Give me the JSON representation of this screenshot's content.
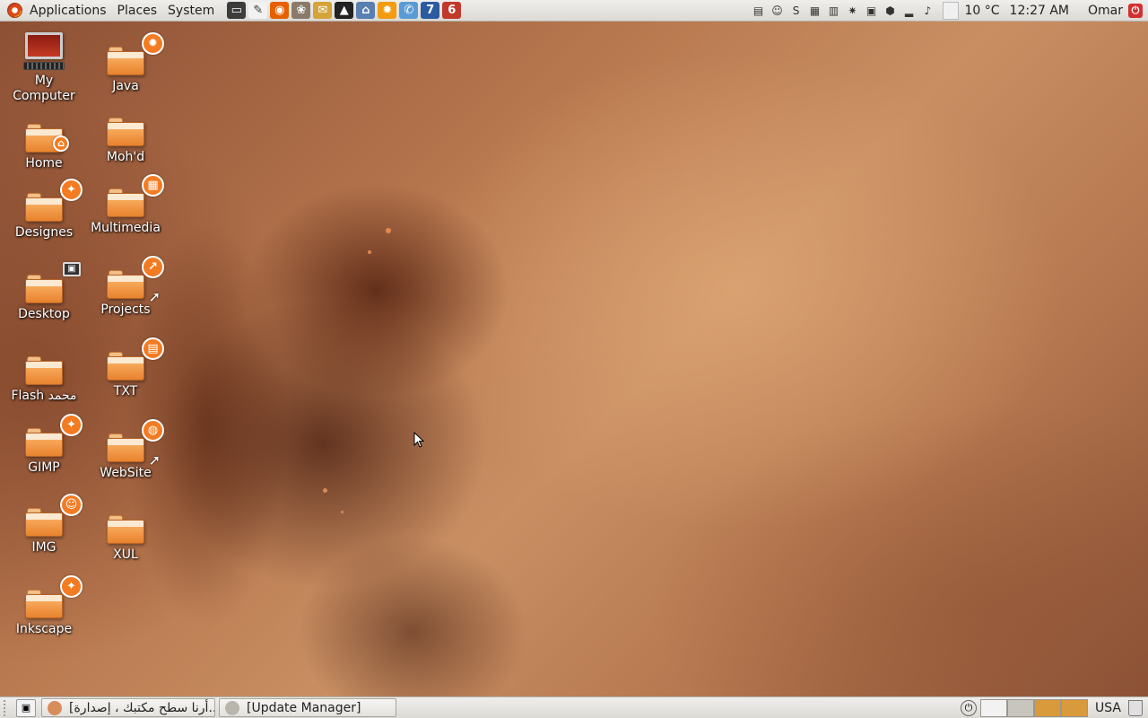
{
  "top_panel": {
    "menus": [
      "Applications",
      "Places",
      "System"
    ],
    "launchers": [
      {
        "icon": "terminal-icon",
        "color": "#3c3c3c",
        "glyph": "▭"
      },
      {
        "icon": "text-editor-icon",
        "color": "#f2f2f2",
        "glyph": "✎"
      },
      {
        "icon": "firefox-icon",
        "color": "#e66000",
        "glyph": "◉"
      },
      {
        "icon": "gimp-icon",
        "color": "#8a7a6a",
        "glyph": "❀"
      },
      {
        "icon": "thunderbird-icon",
        "color": "#d4a33a",
        "glyph": "✉"
      },
      {
        "icon": "inkscape-icon",
        "color": "#222222",
        "glyph": "▲"
      },
      {
        "icon": "network-icon",
        "color": "#5a7fb0",
        "glyph": "⌂"
      },
      {
        "icon": "settings-gear-icon",
        "color": "#f39c12",
        "glyph": "✹"
      },
      {
        "icon": "chat-icon",
        "color": "#5b9bd5",
        "glyph": "✆"
      },
      {
        "icon": "app-7-icon",
        "color": "#2c5aa0",
        "glyph": "7"
      },
      {
        "icon": "app-6-icon",
        "color": "#c0392b",
        "glyph": "6"
      }
    ],
    "tray_icons": [
      {
        "icon": "notes-icon",
        "glyph": "▤"
      },
      {
        "icon": "pidgin-icon",
        "glyph": "☺"
      },
      {
        "icon": "skype-icon",
        "glyph": "S"
      },
      {
        "icon": "system-monitor-icon",
        "glyph": "▦"
      },
      {
        "icon": "calculator-icon",
        "glyph": "▥"
      },
      {
        "icon": "preferences-icon",
        "glyph": "✷"
      },
      {
        "icon": "disk-icon",
        "glyph": "▣"
      },
      {
        "icon": "update-icon",
        "glyph": "⬢"
      },
      {
        "icon": "network-signal-icon",
        "glyph": "▂"
      },
      {
        "icon": "volume-icon",
        "glyph": "♪"
      }
    ],
    "weather": "10 °C",
    "clock": "12:27 AM",
    "user": "Omar"
  },
  "desktop_icons": {
    "column1": [
      {
        "label": "My\nComputer",
        "kind": "computer"
      },
      {
        "label": "Home",
        "emblem": "⌂",
        "emblem_type": "home"
      },
      {
        "label": "Designes",
        "emblem": "✦"
      },
      {
        "label": "Desktop",
        "emblem": "▣",
        "emblem_type": "frame"
      },
      {
        "label": "Flash محمد",
        "emblem": ""
      },
      {
        "label": "GIMP",
        "emblem": "✦"
      },
      {
        "label": "IMG",
        "emblem": "☺"
      },
      {
        "label": "Inkscape",
        "emblem": "✦"
      }
    ],
    "column2": [
      {
        "label": "Java",
        "emblem": "✹"
      },
      {
        "label": "Moh'd",
        "emblem": ""
      },
      {
        "label": "Multimedia",
        "emblem": "▦"
      },
      {
        "label": "Projects",
        "emblem": "↗",
        "link": true
      },
      {
        "label": "TXT",
        "emblem": "▤"
      },
      {
        "label": "WebSite",
        "emblem": "◍",
        "link": true
      },
      {
        "label": "XUL",
        "emblem": ""
      }
    ]
  },
  "bottom_panel": {
    "tasks": [
      {
        "label": "[أرنا سطح مكتبك ، إصدارة...",
        "icon_color": "#d88c5a"
      },
      {
        "label": "[Update Manager]",
        "icon_color": "#b9b6ae"
      }
    ],
    "workspace_colors": [
      "#f2f2f2",
      "#c8c5be",
      "#d89a3a",
      "#d89a3a"
    ],
    "keyboard_layout": "USA"
  }
}
